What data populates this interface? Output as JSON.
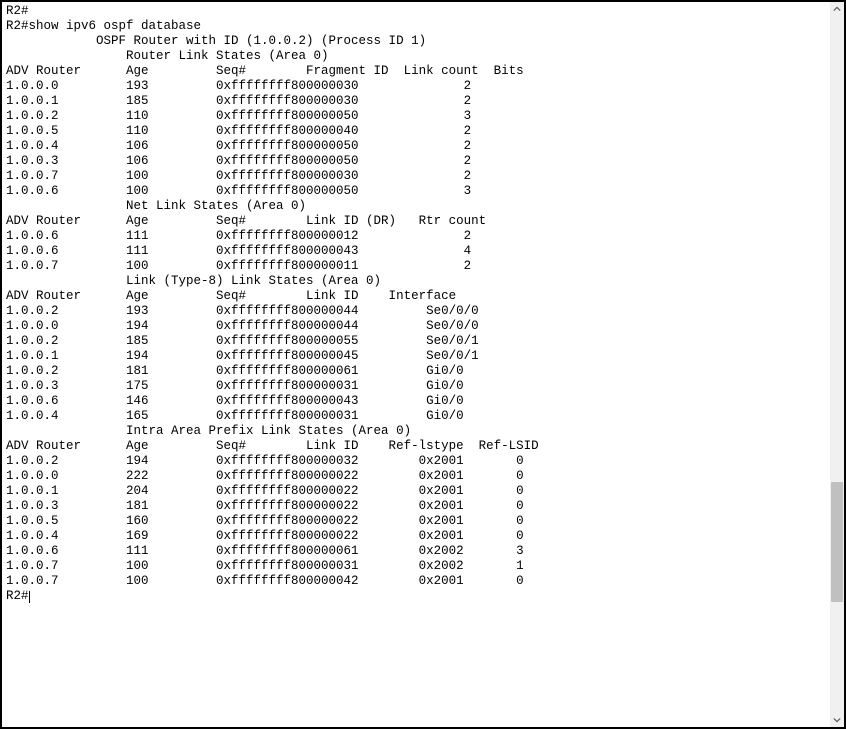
{
  "prompt_line_1": "R2#",
  "prompt_line_2_prefix": "R2#",
  "command": "show ipv6 ospf database",
  "header_line": "            OSPF Router with ID (1.0.0.2) (Process ID 1)",
  "final_prompt": "R2#",
  "sections": [
    {
      "title": "                Router Link States (Area 0)",
      "columns": [
        "ADV Router",
        "Age",
        "Seq#",
        "Fragment ID",
        "Link count",
        "Bits"
      ],
      "header_line": "ADV Router      Age         Seq#        Fragment ID  Link count  Bits",
      "rows": [
        {
          "adv": "1.0.0.0",
          "age": "193",
          "seq": "0xffffffff800000030",
          "frag": "",
          "linkcount": "2"
        },
        {
          "adv": "1.0.0.1",
          "age": "185",
          "seq": "0xffffffff800000030",
          "frag": "",
          "linkcount": "2"
        },
        {
          "adv": "1.0.0.2",
          "age": "110",
          "seq": "0xffffffff800000050",
          "frag": "",
          "linkcount": "3"
        },
        {
          "adv": "1.0.0.5",
          "age": "110",
          "seq": "0xffffffff800000040",
          "frag": "",
          "linkcount": "2"
        },
        {
          "adv": "1.0.0.4",
          "age": "106",
          "seq": "0xffffffff800000050",
          "frag": "",
          "linkcount": "2"
        },
        {
          "adv": "1.0.0.3",
          "age": "106",
          "seq": "0xffffffff800000050",
          "frag": "",
          "linkcount": "2"
        },
        {
          "adv": "1.0.0.7",
          "age": "100",
          "seq": "0xffffffff800000030",
          "frag": "",
          "linkcount": "2"
        },
        {
          "adv": "1.0.0.6",
          "age": "100",
          "seq": "0xffffffff800000050",
          "frag": "",
          "linkcount": "3"
        }
      ]
    },
    {
      "title": "                Net Link States (Area 0)",
      "columns": [
        "ADV Router",
        "Age",
        "Seq#",
        "Link ID (DR)",
        "Rtr count"
      ],
      "header_line": "ADV Router      Age         Seq#        Link ID (DR)   Rtr count",
      "rows": [
        {
          "adv": "1.0.0.6",
          "age": "111",
          "seq": "0xffffffff800000012",
          "rtr": "2"
        },
        {
          "adv": "1.0.0.6",
          "age": "111",
          "seq": "0xffffffff800000043",
          "rtr": "4"
        },
        {
          "adv": "1.0.0.7",
          "age": "100",
          "seq": "0xffffffff800000011",
          "rtr": "2"
        }
      ]
    },
    {
      "title": "                Link (Type-8) Link States (Area 0)",
      "columns": [
        "ADV Router",
        "Age",
        "Seq#",
        "Link ID",
        "Interface"
      ],
      "header_line": "ADV Router      Age         Seq#        Link ID    Interface",
      "rows": [
        {
          "adv": "1.0.0.2",
          "age": "193",
          "seq": "0xffffffff800000044",
          "iface": "Se0/0/0"
        },
        {
          "adv": "1.0.0.0",
          "age": "194",
          "seq": "0xffffffff800000044",
          "iface": "Se0/0/0"
        },
        {
          "adv": "1.0.0.2",
          "age": "185",
          "seq": "0xffffffff800000055",
          "iface": "Se0/0/1"
        },
        {
          "adv": "1.0.0.1",
          "age": "194",
          "seq": "0xffffffff800000045",
          "iface": "Se0/0/1"
        },
        {
          "adv": "1.0.0.2",
          "age": "181",
          "seq": "0xffffffff800000061",
          "iface": "Gi0/0"
        },
        {
          "adv": "1.0.0.3",
          "age": "175",
          "seq": "0xffffffff800000031",
          "iface": "Gi0/0"
        },
        {
          "adv": "1.0.0.6",
          "age": "146",
          "seq": "0xffffffff800000043",
          "iface": "Gi0/0"
        },
        {
          "adv": "1.0.0.4",
          "age": "165",
          "seq": "0xffffffff800000031",
          "iface": "Gi0/0"
        }
      ]
    },
    {
      "title": "                Intra Area Prefix Link States (Area 0)",
      "columns": [
        "ADV Router",
        "Age",
        "Seq#",
        "Link ID",
        "Ref-lstype",
        "Ref-LSID"
      ],
      "header_line": "ADV Router      Age         Seq#        Link ID    Ref-lstype  Ref-LSID",
      "rows": [
        {
          "adv": "1.0.0.2",
          "age": "194",
          "seq": "0xffffffff800000032",
          "ref_lstype": "0x2001",
          "ref_lsid": "0"
        },
        {
          "adv": "1.0.0.0",
          "age": "222",
          "seq": "0xffffffff800000022",
          "ref_lstype": "0x2001",
          "ref_lsid": "0"
        },
        {
          "adv": "1.0.0.1",
          "age": "204",
          "seq": "0xffffffff800000022",
          "ref_lstype": "0x2001",
          "ref_lsid": "0"
        },
        {
          "adv": "1.0.0.3",
          "age": "181",
          "seq": "0xffffffff800000022",
          "ref_lstype": "0x2001",
          "ref_lsid": "0"
        },
        {
          "adv": "1.0.0.5",
          "age": "160",
          "seq": "0xffffffff800000022",
          "ref_lstype": "0x2001",
          "ref_lsid": "0"
        },
        {
          "adv": "1.0.0.4",
          "age": "169",
          "seq": "0xffffffff800000022",
          "ref_lstype": "0x2001",
          "ref_lsid": "0"
        },
        {
          "adv": "1.0.0.6",
          "age": "111",
          "seq": "0xffffffff800000061",
          "ref_lstype": "0x2002",
          "ref_lsid": "3"
        },
        {
          "adv": "1.0.0.7",
          "age": "100",
          "seq": "0xffffffff800000031",
          "ref_lstype": "0x2002",
          "ref_lsid": "1"
        },
        {
          "adv": "1.0.0.7",
          "age": "100",
          "seq": "0xffffffff800000042",
          "ref_lstype": "0x2001",
          "ref_lsid": "0"
        }
      ]
    }
  ]
}
